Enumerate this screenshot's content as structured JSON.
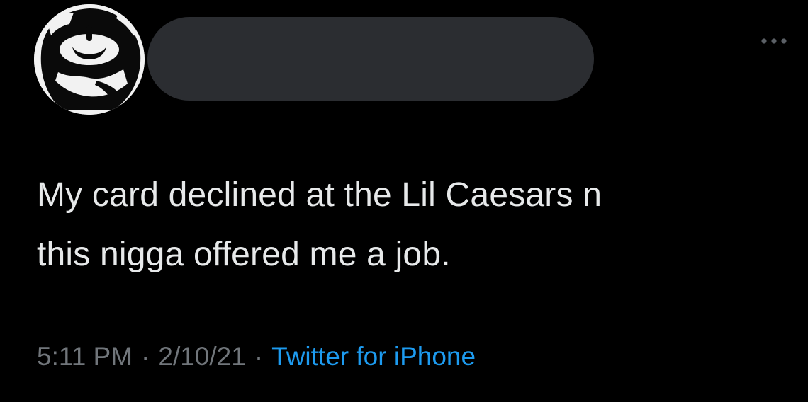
{
  "colors": {
    "background": "#000000",
    "text": "#e7e9ea",
    "meta": "#71767b",
    "link": "#1d9bf0",
    "redaction": "#2b2d31"
  },
  "header": {
    "avatar_icon": "profile-avatar-icon",
    "more_icon": "more-options-icon"
  },
  "tweet": {
    "lines": [
      "My card declined at the Lil Caesars n",
      "this nigga offered me a job."
    ]
  },
  "meta": {
    "time": "5:11 PM",
    "separator": "·",
    "date": "2/10/21",
    "source": "Twitter for iPhone"
  }
}
